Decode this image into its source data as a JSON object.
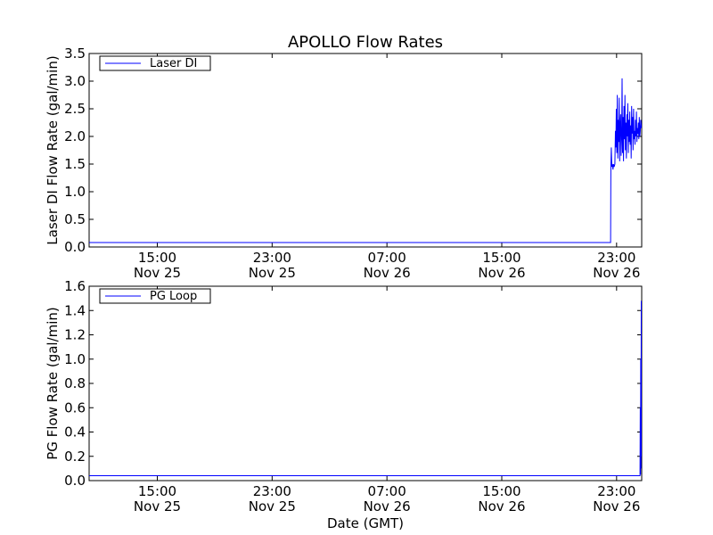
{
  "figure": {
    "title": "APOLLO Flow Rates",
    "xlabel": "Date (GMT)"
  },
  "colors": {
    "series": "#0000ff",
    "axes": "#000000",
    "background": "#ffffff"
  },
  "chart_data": [
    {
      "type": "line",
      "title": "APOLLO Flow Rates",
      "xlabel": "",
      "ylabel": "Laser DI Flow Rate (gal/min)",
      "ylim": [
        0,
        3.5
      ],
      "xlim": [
        "2010-11-25 10:15",
        "2010-11-27 00:45"
      ],
      "yticks": [
        "0.0",
        "0.5",
        "1.0",
        "1.5",
        "2.0",
        "2.5",
        "3.0",
        "3.5"
      ],
      "xticks": [
        {
          "value": "2010-11-25 15:00",
          "time": "15:00",
          "date": "Nov 25"
        },
        {
          "value": "2010-11-25 23:00",
          "time": "23:00",
          "date": "Nov 25"
        },
        {
          "value": "2010-11-26 07:00",
          "time": "07:00",
          "date": "Nov 26"
        },
        {
          "value": "2010-11-26 15:00",
          "time": "15:00",
          "date": "Nov 26"
        },
        {
          "value": "2010-11-26 23:00",
          "time": "23:00",
          "date": "Nov 26"
        }
      ],
      "legend": {
        "placement": "top-left",
        "entries": [
          "Laser DI"
        ]
      },
      "grid": false,
      "series": [
        {
          "name": "Laser DI",
          "x": [
            "2010-11-25 10:15",
            "2010-11-26 22:35",
            "2010-11-26 22:36",
            "2010-11-26 22:38",
            "2010-11-26 22:40",
            "2010-11-26 22:42",
            "2010-11-26 22:45",
            "2010-11-26 22:47",
            "2010-11-26 22:50",
            "2010-11-26 22:53",
            "2010-11-26 22:55",
            "2010-11-26 22:57",
            "2010-11-26 22:59",
            "2010-11-26 23:01",
            "2010-11-26 23:03",
            "2010-11-26 23:05",
            "2010-11-26 23:07",
            "2010-11-26 23:09",
            "2010-11-26 23:11",
            "2010-11-26 23:13",
            "2010-11-26 23:15",
            "2010-11-26 23:17",
            "2010-11-26 23:19",
            "2010-11-26 23:21",
            "2010-11-26 23:23",
            "2010-11-26 23:25",
            "2010-11-26 23:27",
            "2010-11-26 23:29",
            "2010-11-26 23:31",
            "2010-11-26 23:33",
            "2010-11-26 23:35",
            "2010-11-26 23:37",
            "2010-11-26 23:39",
            "2010-11-26 23:41",
            "2010-11-26 23:43",
            "2010-11-26 23:45",
            "2010-11-26 23:47",
            "2010-11-26 23:49",
            "2010-11-26 23:51",
            "2010-11-26 23:53",
            "2010-11-26 23:55",
            "2010-11-26 23:57",
            "2010-11-26 23:59",
            "2010-11-27 00:01",
            "2010-11-27 00:03",
            "2010-11-27 00:05",
            "2010-11-27 00:07",
            "2010-11-27 00:09",
            "2010-11-27 00:11",
            "2010-11-27 00:13",
            "2010-11-27 00:15",
            "2010-11-27 00:17",
            "2010-11-27 00:19",
            "2010-11-27 00:21",
            "2010-11-27 00:23",
            "2010-11-27 00:25",
            "2010-11-27 00:27",
            "2010-11-27 00:29",
            "2010-11-27 00:31",
            "2010-11-27 00:33",
            "2010-11-27 00:35",
            "2010-11-27 00:37",
            "2010-11-27 00:39",
            "2010-11-27 00:41",
            "2010-11-27 00:43",
            "2010-11-27 00:45"
          ],
          "values": [
            0.08,
            0.08,
            1.45,
            1.8,
            1.45,
            1.5,
            1.4,
            1.5,
            1.45,
            1.5,
            2.1,
            1.8,
            2.5,
            1.7,
            2.75,
            1.6,
            2.3,
            1.9,
            2.7,
            1.55,
            2.2,
            2.4,
            1.65,
            2.0,
            3.05,
            1.7,
            2.35,
            1.55,
            2.55,
            1.95,
            2.75,
            1.75,
            2.25,
            1.6,
            2.4,
            2.0,
            2.6,
            1.7,
            2.3,
            1.9,
            2.45,
            1.85,
            2.2,
            1.6,
            2.55,
            2.05,
            2.35,
            1.75,
            2.5,
            1.95,
            2.1,
            1.85,
            2.3,
            2.0,
            2.45,
            1.9,
            2.15,
            2.05,
            2.25,
            1.95,
            2.35,
            2.0,
            2.1,
            2.3,
            2.2,
            2.15
          ]
        }
      ]
    },
    {
      "type": "line",
      "title": "",
      "xlabel": "Date (GMT)",
      "ylabel": "PG Flow Rate (gal/min)",
      "ylim": [
        0,
        1.6
      ],
      "xlim": [
        "2010-11-25 10:15",
        "2010-11-27 00:45"
      ],
      "yticks": [
        "0.0",
        "0.2",
        "0.4",
        "0.6",
        "0.8",
        "1.0",
        "1.2",
        "1.4",
        "1.6"
      ],
      "xticks": [
        {
          "value": "2010-11-25 15:00",
          "time": "15:00",
          "date": "Nov 25"
        },
        {
          "value": "2010-11-25 23:00",
          "time": "23:00",
          "date": "Nov 25"
        },
        {
          "value": "2010-11-26 07:00",
          "time": "07:00",
          "date": "Nov 26"
        },
        {
          "value": "2010-11-26 15:00",
          "time": "15:00",
          "date": "Nov 26"
        },
        {
          "value": "2010-11-26 23:00",
          "time": "23:00",
          "date": "Nov 26"
        }
      ],
      "legend": {
        "placement": "top-left",
        "entries": [
          "PG Loop"
        ]
      },
      "grid": false,
      "series": [
        {
          "name": "PG Loop",
          "x": [
            "2010-11-25 10:15",
            "2010-11-25 14:00",
            "2010-11-25 18:00",
            "2010-11-25 22:00",
            "2010-11-26 02:00",
            "2010-11-26 06:00",
            "2010-11-26 10:00",
            "2010-11-26 14:00",
            "2010-11-26 18:00",
            "2010-11-26 22:00",
            "2010-11-27 00:38",
            "2010-11-27 00:39",
            "2010-11-27 00:40",
            "2010-11-27 00:41",
            "2010-11-27 00:42",
            "2010-11-27 00:43",
            "2010-11-27 00:44",
            "2010-11-27 00:45"
          ],
          "values": [
            0.04,
            0.04,
            0.04,
            0.04,
            0.04,
            0.04,
            0.04,
            0.04,
            0.04,
            0.04,
            0.04,
            0.6,
            0.05,
            1.0,
            0.1,
            1.48,
            0.2,
            1.4
          ]
        }
      ]
    }
  ]
}
